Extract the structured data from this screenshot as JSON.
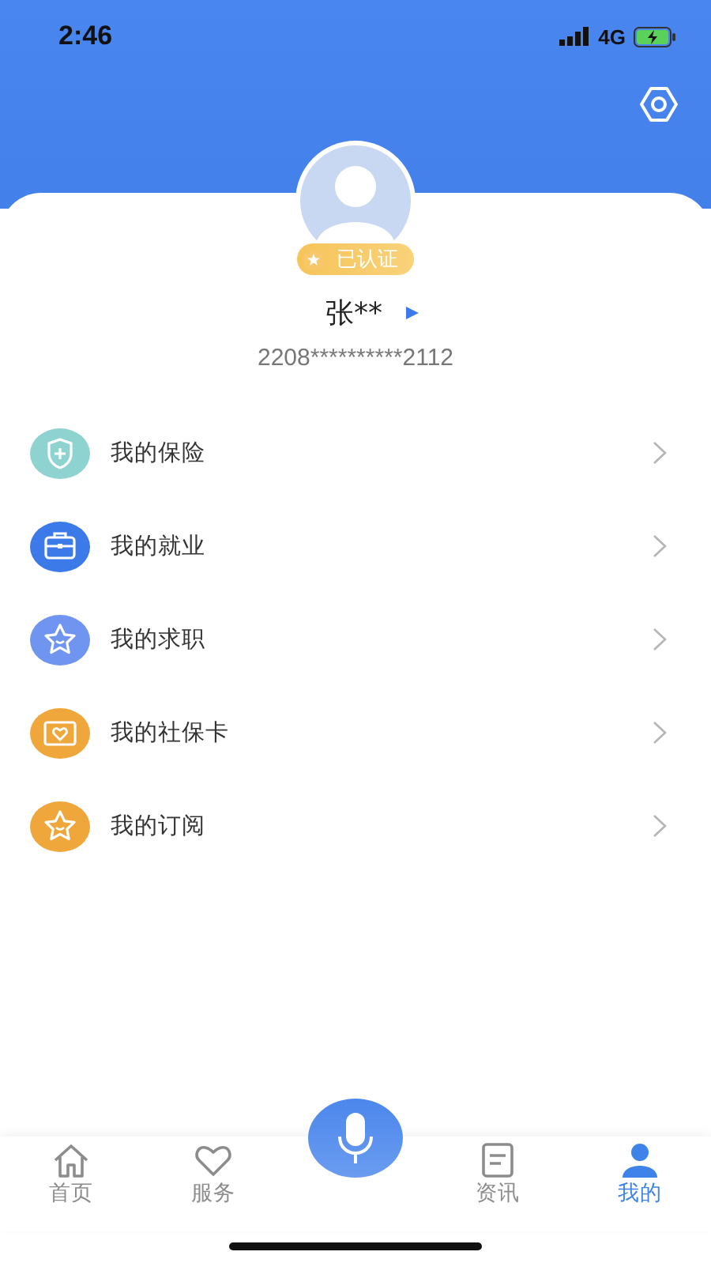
{
  "status_bar": {
    "time": "2:46",
    "network": "4G"
  },
  "profile": {
    "badge": "已认证",
    "name": "张**",
    "id_number": "2208**********2112"
  },
  "menu": [
    {
      "label": "我的保险",
      "kind": "shield",
      "color": "#8fd3d0"
    },
    {
      "label": "我的就业",
      "kind": "briefcase",
      "color": "#3b7ae8"
    },
    {
      "label": "我的求职",
      "kind": "star",
      "color": "#6f95f0"
    },
    {
      "label": "我的社保卡",
      "kind": "card",
      "color": "#efa63a"
    },
    {
      "label": "我的订阅",
      "kind": "star",
      "color": "#efa63a"
    }
  ],
  "tab_bar": [
    {
      "label": "首页",
      "kind": "home",
      "selected": false
    },
    {
      "label": "服务",
      "kind": "heart",
      "selected": false
    },
    {
      "label": "资讯",
      "kind": "news",
      "selected": false
    },
    {
      "label": "我的",
      "kind": "person",
      "selected": true
    }
  ]
}
